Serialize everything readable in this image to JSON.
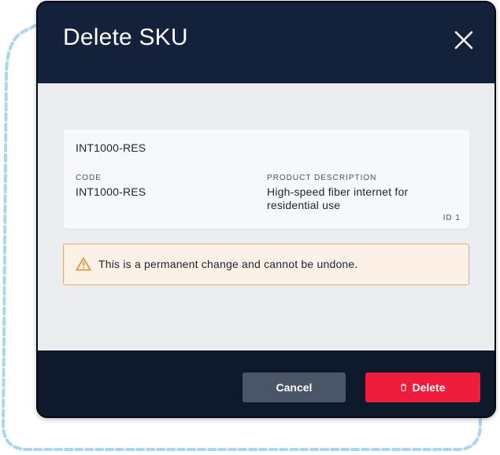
{
  "dialog": {
    "title": "Delete SKU",
    "close_icon": "close-icon"
  },
  "sku_card": {
    "title": "INT1000-RES",
    "code_label": "CODE",
    "code_value": "INT1000-RES",
    "description_label": "PRODUCT DESCRIPTION",
    "description_value": "High-speed fiber internet for residential use",
    "id_label": "ID 1"
  },
  "warning": {
    "icon": "warning-triangle-icon",
    "text": "This is a permanent change and cannot be undone.",
    "border_color": "#e9ad6a",
    "background_color": "#fdf1e7"
  },
  "footer": {
    "cancel_label": "Cancel",
    "delete_label": "Delete",
    "delete_icon": "trash-icon",
    "delete_color": "#ef1d3c",
    "cancel_color": "#4b5568"
  }
}
